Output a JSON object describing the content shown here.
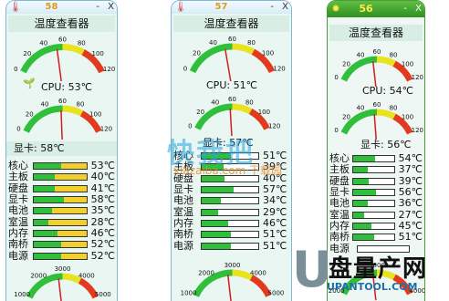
{
  "windows": [
    {
      "title_number": "58",
      "minimize_label": "-",
      "close_label": "X",
      "heading": "温度查看器",
      "gauge_ticks": [
        "0",
        "20",
        "40",
        "60",
        "80",
        "100",
        "120"
      ],
      "cpu_label": "CPU: 53℃",
      "gpu_label": "显卡: 58℃",
      "sensors": [
        {
          "name": "核心",
          "value": "53℃",
          "level": 0.53
        },
        {
          "name": "主板",
          "value": "40℃",
          "level": 0.4
        },
        {
          "name": "硬盘",
          "value": "41℃",
          "level": 0.41
        },
        {
          "name": "显卡",
          "value": "58℃",
          "level": 0.58
        },
        {
          "name": "电池",
          "value": "35℃",
          "level": 0.35
        },
        {
          "name": "室温",
          "value": "28℃",
          "level": 0.28
        },
        {
          "name": "内存",
          "value": "46℃",
          "level": 0.46
        },
        {
          "name": "南桥",
          "value": "52℃",
          "level": 0.52
        },
        {
          "name": "电源",
          "value": "52℃",
          "level": 0.52
        }
      ],
      "fan_ticks": [
        "1000",
        "2000",
        "3000",
        "4000",
        "5000"
      ]
    },
    {
      "title_number": "57",
      "minimize_label": "-",
      "close_label": "X",
      "heading": "温度查看器",
      "gauge_ticks": [
        "0",
        "20",
        "40",
        "60",
        "80",
        "100",
        "120"
      ],
      "cpu_label": "CPU: 51℃",
      "gpu_label": "显卡: 57℃",
      "sensors": [
        {
          "name": "核心",
          "value": "51℃",
          "level": 0.51
        },
        {
          "name": "主板",
          "value": "39℃",
          "level": 0.39
        },
        {
          "name": "硬盘",
          "value": "40℃",
          "level": 0.4
        },
        {
          "name": "显卡",
          "value": "57℃",
          "level": 0.57
        },
        {
          "name": "电池",
          "value": "34℃",
          "level": 0.34
        },
        {
          "name": "室温",
          "value": "29℃",
          "level": 0.29
        },
        {
          "name": "内存",
          "value": "46℃",
          "level": 0.46
        },
        {
          "name": "南桥",
          "value": "51℃",
          "level": 0.51
        },
        {
          "name": "电源",
          "value": "51℃",
          "level": 0.51
        }
      ],
      "fan_ticks": [
        "1000",
        "2000",
        "3000",
        "4000",
        "5000"
      ]
    },
    {
      "title_number": "56",
      "minimize_label": "-",
      "close_label": "X",
      "heading": "温度查看器",
      "gauge_ticks": [
        "0",
        "20",
        "40",
        "60",
        "80",
        "100",
        "120"
      ],
      "cpu_label": "CPU: 54℃",
      "gpu_label": "显卡: 56℃",
      "sensors": [
        {
          "name": "核心",
          "value": "54℃",
          "level": 0.54
        },
        {
          "name": "主板",
          "value": "37℃",
          "level": 0.37
        },
        {
          "name": "硬盘",
          "value": "39℃",
          "level": 0.39
        },
        {
          "name": "显卡",
          "value": "56℃",
          "level": 0.56
        },
        {
          "name": "电池",
          "value": "36℃",
          "level": 0.36
        },
        {
          "name": "室温",
          "value": "27℃",
          "level": 0.27
        },
        {
          "name": "内存",
          "value": "45℃",
          "level": 0.45
        },
        {
          "name": "南桥",
          "value": "51℃",
          "level": 0.51
        },
        {
          "name": "电源",
          "value": "",
          "level": 0
        }
      ],
      "fan_ticks": [
        "2000",
        "3000",
        "4000"
      ]
    }
  ],
  "watermark": {
    "logo_text": "快我把",
    "logo_sub": "xiazaiba.com·下载园",
    "big_letter": "U",
    "big_text": "盘量产网",
    "url": "UPANTOOL.COM"
  },
  "colors": {
    "gauge_green": "#2fbf3a",
    "gauge_yellow": "#e8e21f",
    "gauge_red": "#e23a1e",
    "needle": "#d11e1e",
    "active_title": "#3a9a2a"
  },
  "icons": {
    "window_icon": "thermometer-icon",
    "active_window_icon": "sun-icon",
    "cpu_icon": "plant-icon"
  }
}
